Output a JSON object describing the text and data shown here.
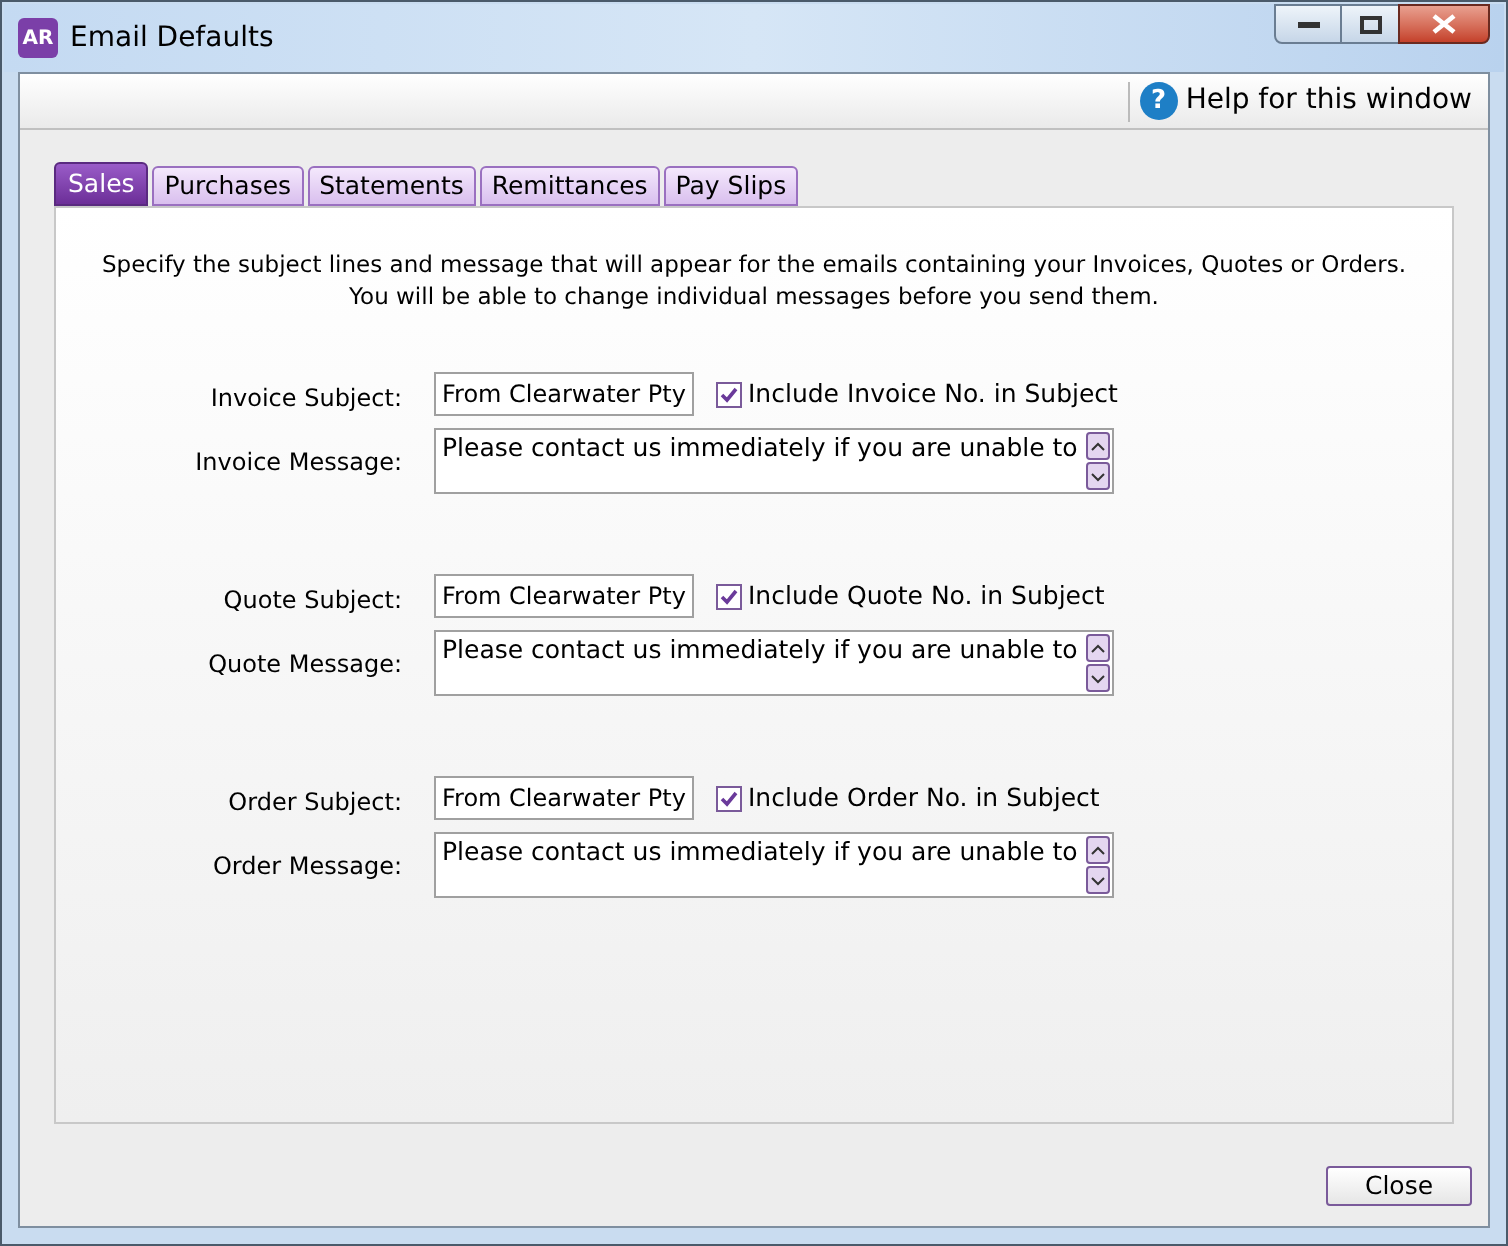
{
  "window": {
    "title": "Email Defaults",
    "app_badge": "AR"
  },
  "help": {
    "icon_glyph": "?",
    "label": "Help for this window"
  },
  "tabs": [
    {
      "label": "Sales",
      "selected": true
    },
    {
      "label": "Purchases",
      "selected": false
    },
    {
      "label": "Statements",
      "selected": false
    },
    {
      "label": "Remittances",
      "selected": false
    },
    {
      "label": "Pay Slips",
      "selected": false
    }
  ],
  "intro": [
    "Specify the subject lines and message that will appear for the emails containing your Invoices, Quotes or Orders.",
    "You will be able to change individual messages before you send them."
  ],
  "groups": [
    {
      "subject_label": "Invoice Subject:",
      "subject": "From Clearwater Pty",
      "include_label": "Include Invoice No. in Subject",
      "include_checked": true,
      "message_label": "Invoice Message:",
      "message": "Please contact us immediately if you are unable to"
    },
    {
      "subject_label": "Quote Subject:",
      "subject": "From Clearwater Pty",
      "include_label": "Include Quote No. in Subject",
      "include_checked": true,
      "message_label": "Quote Message:",
      "message": "Please contact us immediately if you are unable to"
    },
    {
      "subject_label": "Order Subject:",
      "subject": "From Clearwater Pty",
      "include_label": "Include Order No. in Subject",
      "include_checked": true,
      "message_label": "Order Message:",
      "message": "Please contact us immediately if you are unable to"
    }
  ],
  "buttons": [
    "Close"
  ]
}
